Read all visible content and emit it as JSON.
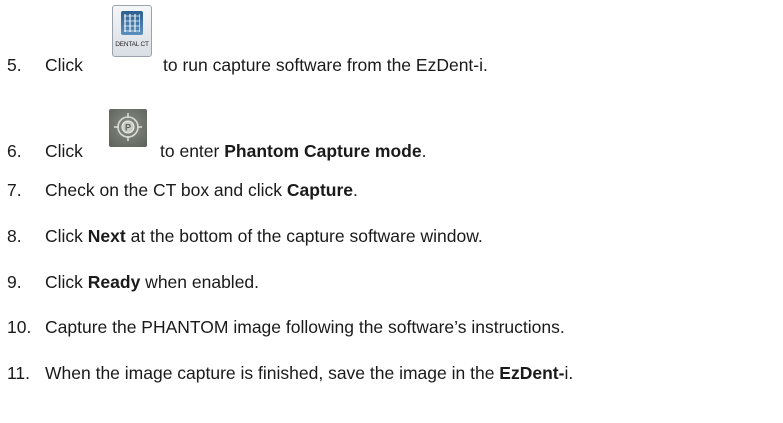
{
  "steps": [
    {
      "number": "5.",
      "before": "Click",
      "icon": "dental-ct-icon",
      "icon_caption": "DENTAL CT",
      "after": "to run capture software from the EzDent-i."
    },
    {
      "number": "6.",
      "before": "Click",
      "icon": "phantom-capture-icon",
      "after": "to enter ",
      "bold": "Phantom Capture mode",
      "tail": "."
    },
    {
      "number": "7.",
      "before": "Check on the CT box and click ",
      "bold": "Capture",
      "tail": "."
    },
    {
      "number": "8.",
      "before": "Click ",
      "bold": "Next",
      "tail": " at the bottom of the capture software window."
    },
    {
      "number": "9.",
      "before": "Click ",
      "bold": "Ready",
      "tail": " when enabled."
    },
    {
      "number": "10.",
      "text": "Capture the PHANTOM image following the software’s instructions."
    },
    {
      "number": "11.",
      "before": "When the image capture is finished, save the image in the ",
      "bold": "EzDent-",
      "tail": "i."
    }
  ]
}
